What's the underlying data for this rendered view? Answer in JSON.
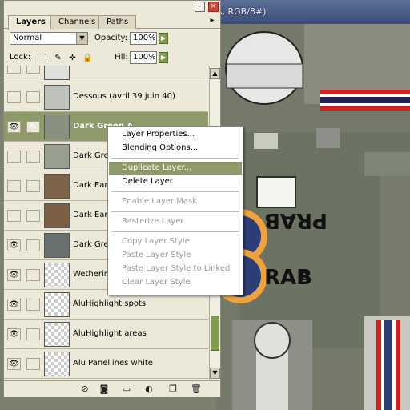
{
  "document": {
    "title_fragment": "A, RGB/8#)"
  },
  "window_controls": {
    "minimize": "–",
    "close": "×"
  },
  "tabs": [
    {
      "label": "Layers",
      "active": true
    },
    {
      "label": "Channels",
      "active": false
    },
    {
      "label": "Paths",
      "active": false
    }
  ],
  "panel_menu_icon": "▸",
  "blend_mode": {
    "value": "Normal"
  },
  "opacity": {
    "label": "Opacity:",
    "value": "100%"
  },
  "fill": {
    "label": "Fill:",
    "value": "100%"
  },
  "lock": {
    "label": "Lock:"
  },
  "layers": [
    {
      "name": "",
      "visible": false,
      "linked": false,
      "selected": false,
      "thumb": "#dfe0dc"
    },
    {
      "name": "Dessous (avril 39 juin 40)",
      "visible": false,
      "linked": false,
      "selected": false,
      "thumb": "#bfc1bb"
    },
    {
      "name": "Dark Green A",
      "visible": true,
      "linked": true,
      "selected": true,
      "thumb": "#8a9080"
    },
    {
      "name": "Dark Gre",
      "visible": false,
      "linked": false,
      "selected": false,
      "thumb": "#9aa090"
    },
    {
      "name": "Dark Eart",
      "visible": false,
      "linked": false,
      "selected": false,
      "thumb": "#7d6448"
    },
    {
      "name": "Dark Eart",
      "visible": false,
      "linked": false,
      "selected": false,
      "thumb": "#7b6045"
    },
    {
      "name": "Dark Gre",
      "visible": true,
      "linked": false,
      "selected": false,
      "thumb": "#697070"
    },
    {
      "name": "Wethering",
      "visible": true,
      "linked": false,
      "selected": false,
      "thumb": "checker"
    },
    {
      "name": "AluHighlight spots",
      "visible": true,
      "linked": false,
      "selected": false,
      "thumb": "checker"
    },
    {
      "name": "AluHighlight areas",
      "visible": true,
      "linked": false,
      "selected": false,
      "thumb": "checker"
    },
    {
      "name": "Alu Panellines white",
      "visible": true,
      "linked": false,
      "selected": false,
      "thumb": "checker"
    }
  ],
  "context_menu": {
    "items": [
      {
        "label": "Layer Properties...",
        "enabled": true,
        "highlighted": false
      },
      {
        "label": "Blending Options...",
        "enabled": true,
        "highlighted": false
      },
      {
        "separator": true
      },
      {
        "label": "Duplicate Layer...",
        "enabled": true,
        "highlighted": true
      },
      {
        "label": "Delete Layer",
        "enabled": true,
        "highlighted": false
      },
      {
        "separator": true
      },
      {
        "label": "Enable Layer Mask",
        "enabled": false,
        "highlighted": false
      },
      {
        "separator": true
      },
      {
        "label": "Rasterize Layer",
        "enabled": false,
        "highlighted": false
      },
      {
        "separator": true
      },
      {
        "label": "Copy Layer Style",
        "enabled": false,
        "highlighted": false
      },
      {
        "label": "Paste Layer Style",
        "enabled": false,
        "highlighted": false
      },
      {
        "label": "Paste Layer Style to Linked",
        "enabled": false,
        "highlighted": false
      },
      {
        "label": "Clear Layer Style",
        "enabled": false,
        "highlighted": false
      }
    ]
  },
  "canvas_text": {
    "marking_top": "PRAB",
    "marking_bottom": "RAB",
    "tail_code": "B"
  },
  "bottom_icons": [
    "link-styles-icon",
    "add-mask-icon",
    "new-set-icon",
    "adjustment-layer-icon",
    "new-layer-icon",
    "trash-icon"
  ],
  "colors": {
    "accent": "#8f9a6a",
    "scrollbar": "#7e9b4e",
    "panel_bg": "#ece9d8"
  }
}
